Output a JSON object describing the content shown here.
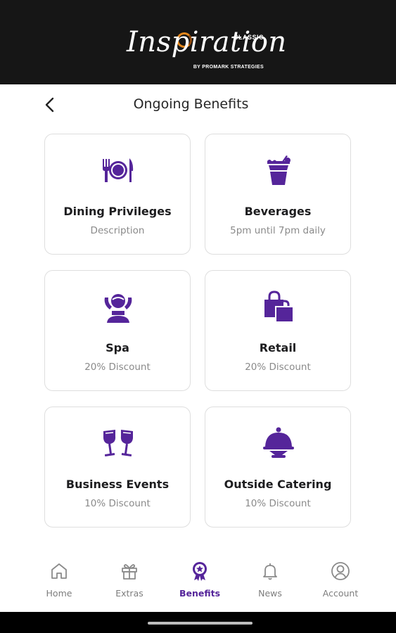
{
  "brand": {
    "script": "Inspiration",
    "edition": "CLASSIC",
    "byline": "BY PROMARK STRATEGIES",
    "ring_color": "#e5881d"
  },
  "page": {
    "title": "Ongoing Benefits",
    "back_icon": "chevron-left-icon"
  },
  "accent": "#55259a",
  "benefits": [
    {
      "title": "Dining Privileges",
      "subtitle": "Description",
      "icon": "dining-plate-icon"
    },
    {
      "title": "Beverages",
      "subtitle": "5pm until 7pm daily",
      "icon": "cocktail-drink-icon"
    },
    {
      "title": "Spa",
      "subtitle": "20% Discount",
      "icon": "spa-person-icon"
    },
    {
      "title": "Retail",
      "subtitle": "20% Discount",
      "icon": "shopping-bags-icon"
    },
    {
      "title": "Business Events",
      "subtitle": "10% Discount",
      "icon": "wine-glasses-toast-icon"
    },
    {
      "title": "Outside Catering",
      "subtitle": "10% Discount",
      "icon": "serving-cloche-icon"
    }
  ],
  "tabs": [
    {
      "label": "Home",
      "icon": "home-icon",
      "active": false
    },
    {
      "label": "Extras",
      "icon": "gift-icon",
      "active": false
    },
    {
      "label": "Benefits",
      "icon": "award-badge-icon",
      "active": true
    },
    {
      "label": "News",
      "icon": "bell-icon",
      "active": false
    },
    {
      "label": "Account",
      "icon": "user-circle-icon",
      "active": false
    }
  ]
}
